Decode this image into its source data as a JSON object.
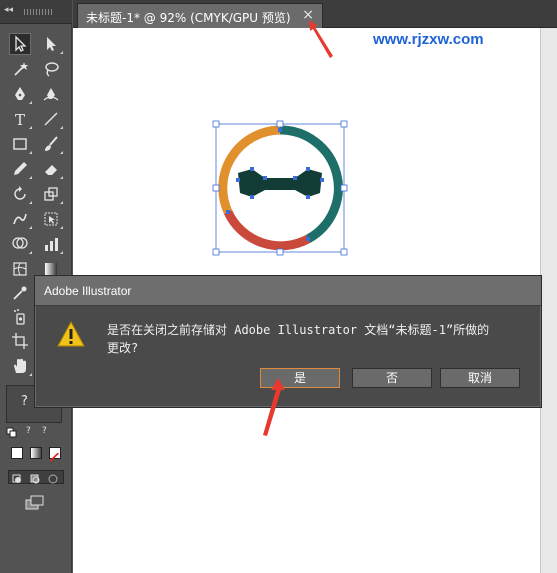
{
  "document_tab": {
    "title": "未标题-1* @ 92% (CMYK/GPU 预览)",
    "close_glyph": "×"
  },
  "watermark": "www.rjzxw.com",
  "tools_panel": {
    "collapse_glyph": "◂◂",
    "tools": [
      {
        "name": "selection-tool",
        "icon": "arrow-icon"
      },
      {
        "name": "direct-selection-tool",
        "icon": "hollow-arrow-icon"
      },
      {
        "name": "magic-wand-tool",
        "icon": "magic-wand-icon"
      },
      {
        "name": "lasso-tool",
        "icon": "lasso-icon"
      },
      {
        "name": "pen-tool",
        "icon": "pen-icon"
      },
      {
        "name": "curvature-tool",
        "icon": "curvature-pen-icon"
      },
      {
        "name": "type-tool",
        "icon": "type-icon"
      },
      {
        "name": "line-tool",
        "icon": "line-icon"
      },
      {
        "name": "rectangle-tool",
        "icon": "rectangle-icon"
      },
      {
        "name": "paintbrush-tool",
        "icon": "brush-icon"
      },
      {
        "name": "pencil-tool",
        "icon": "pencil-icon"
      },
      {
        "name": "eraser-tool",
        "icon": "eraser-icon"
      },
      {
        "name": "rotate-tool",
        "icon": "rotate-icon"
      },
      {
        "name": "scale-tool",
        "icon": "scale-icon"
      },
      {
        "name": "warp-tool",
        "icon": "warp-icon"
      },
      {
        "name": "free-transform-tool",
        "icon": "free-transform-icon"
      },
      {
        "name": "shape-builder-tool",
        "icon": "shape-builder-icon"
      },
      {
        "name": "graph-tool",
        "icon": "graph-icon"
      },
      {
        "name": "mesh-tool",
        "icon": "mesh-icon"
      },
      {
        "name": "gradient-tool",
        "icon": "gradient-icon"
      },
      {
        "name": "eyedropper-tool",
        "icon": "eyedropper-icon"
      },
      {
        "name": "symbol-sprayer-tool",
        "icon": "sprayer-icon"
      },
      {
        "name": "artboard-tool",
        "icon": "artboard-icon"
      },
      {
        "name": "hand-tool",
        "icon": "hand-icon"
      }
    ],
    "fill_stroke_label": "?",
    "swap_glyph": "?",
    "default_glyph": "?"
  },
  "artwork_colors": {
    "ring_orange": "#e0902c",
    "ring_teal": "#1e6f6a",
    "ring_red": "#c94a3a",
    "bowtie": "#123c35",
    "selection": "#3c6cd8"
  },
  "dialog": {
    "title": "Adobe Illustrator",
    "icon": "warning-icon",
    "message_line1": "是否在关闭之前存储对 Adobe Illustrator 文档“未标题-1”所做的",
    "message_line2": "更改?",
    "buttons": {
      "yes": "是",
      "no": "否",
      "cancel": "取消"
    }
  },
  "annotation_arrow_color": "#e8392f"
}
